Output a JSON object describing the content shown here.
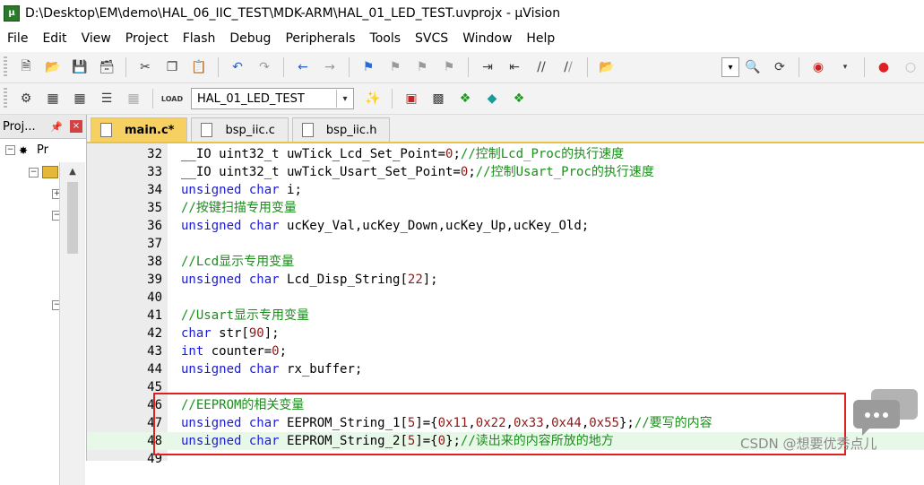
{
  "window": {
    "title": "D:\\Desktop\\EM\\demo\\HAL_06_IIC_TEST\\MDK-ARM\\HAL_01_LED_TEST.uvprojx - µVision"
  },
  "menubar": {
    "items": [
      "File",
      "Edit",
      "View",
      "Project",
      "Flash",
      "Debug",
      "Peripherals",
      "Tools",
      "SVCS",
      "Window",
      "Help"
    ]
  },
  "toolbar2": {
    "target_value": "HAL_01_LED_TEST"
  },
  "project_panel": {
    "title": "Proj...",
    "root_label": "Pr"
  },
  "tabs": [
    {
      "label": "main.c*",
      "active": true
    },
    {
      "label": "bsp_iic.c",
      "active": false
    },
    {
      "label": "bsp_iic.h",
      "active": false
    }
  ],
  "code_lines": [
    {
      "num": "32",
      "parts": [
        [
          "",
          "__IO uint32_t uwTick_Lcd_Set_Point="
        ],
        [
          "nm",
          "0"
        ],
        [
          "",
          ";"
        ],
        [
          "cm",
          "//控制Lcd_Proc的执行速度"
        ]
      ]
    },
    {
      "num": "33",
      "parts": [
        [
          "",
          "__IO uint32_t uwTick_Usart_Set_Point="
        ],
        [
          "nm",
          "0"
        ],
        [
          "",
          ";"
        ],
        [
          "cm",
          "//控制Usart_Proc的执行速度"
        ]
      ]
    },
    {
      "num": "34",
      "parts": [
        [
          "kw",
          "unsigned"
        ],
        [
          "",
          " "
        ],
        [
          "kw",
          "char"
        ],
        [
          "",
          " i;"
        ]
      ]
    },
    {
      "num": "35",
      "parts": [
        [
          "cm",
          "//按键扫描专用变量"
        ]
      ]
    },
    {
      "num": "36",
      "parts": [
        [
          "kw",
          "unsigned"
        ],
        [
          "",
          " "
        ],
        [
          "kw",
          "char"
        ],
        [
          "",
          " ucKey_Val,ucKey_Down,ucKey_Up,ucKey_Old;"
        ]
      ]
    },
    {
      "num": "37",
      "parts": []
    },
    {
      "num": "38",
      "parts": [
        [
          "cm",
          "//Lcd显示专用变量"
        ]
      ]
    },
    {
      "num": "39",
      "parts": [
        [
          "kw",
          "unsigned"
        ],
        [
          "",
          " "
        ],
        [
          "kw",
          "char"
        ],
        [
          "",
          " Lcd_Disp_String["
        ],
        [
          "nm",
          "22"
        ],
        [
          "",
          "];"
        ]
      ]
    },
    {
      "num": "40",
      "parts": []
    },
    {
      "num": "41",
      "parts": [
        [
          "cm",
          "//Usart显示专用变量"
        ]
      ]
    },
    {
      "num": "42",
      "parts": [
        [
          "kw",
          "char"
        ],
        [
          "",
          " str["
        ],
        [
          "nm",
          "90"
        ],
        [
          "",
          "];"
        ]
      ]
    },
    {
      "num": "43",
      "parts": [
        [
          "kw",
          "int"
        ],
        [
          "",
          " counter="
        ],
        [
          "nm",
          "0"
        ],
        [
          "",
          ";"
        ]
      ]
    },
    {
      "num": "44",
      "parts": [
        [
          "kw",
          "unsigned"
        ],
        [
          "",
          " "
        ],
        [
          "kw",
          "char"
        ],
        [
          "",
          " rx_buffer;"
        ]
      ]
    },
    {
      "num": "45",
      "parts": []
    },
    {
      "num": "46",
      "parts": [
        [
          "cm",
          "//EEPROM的相关变量"
        ]
      ]
    },
    {
      "num": "47",
      "parts": [
        [
          "kw",
          "unsigned"
        ],
        [
          "",
          " "
        ],
        [
          "kw",
          "char"
        ],
        [
          "",
          " EEPROM_String_1["
        ],
        [
          "nm",
          "5"
        ],
        [
          "",
          "]={"
        ],
        [
          "nm",
          "0x11"
        ],
        [
          "",
          ","
        ],
        [
          "nm",
          "0x22"
        ],
        [
          "",
          ","
        ],
        [
          "nm",
          "0x33"
        ],
        [
          "",
          ","
        ],
        [
          "nm",
          "0x44"
        ],
        [
          "",
          ","
        ],
        [
          "nm",
          "0x55"
        ],
        [
          "",
          "};"
        ],
        [
          "cm",
          "//要写的内容"
        ]
      ]
    },
    {
      "num": "48",
      "parts": [
        [
          "kw",
          "unsigned"
        ],
        [
          "",
          " "
        ],
        [
          "kw",
          "char"
        ],
        [
          "",
          " EEPROM_String_2["
        ],
        [
          "nm",
          "5"
        ],
        [
          "",
          "]={"
        ],
        [
          "nm",
          "0"
        ],
        [
          "",
          "};"
        ],
        [
          "cm",
          "//读出来的内容所放的地方"
        ]
      ]
    },
    {
      "num": "49",
      "parts": []
    }
  ],
  "watermark": "CSDN @想要优秀点儿",
  "colors": {
    "keyword": "#1b1bd6",
    "comment": "#1b8e1b",
    "number": "#8b1a1a",
    "highlight_box": "#e02020",
    "active_tab": "#f6d060"
  }
}
